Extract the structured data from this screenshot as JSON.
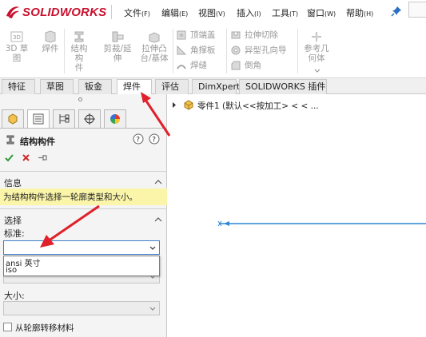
{
  "app": {
    "brand": "SOLIDWORKS",
    "brand_color": "#c8102e"
  },
  "menu": {
    "items": [
      {
        "label": "文件",
        "accel": "(F)"
      },
      {
        "label": "编辑",
        "accel": "(E)"
      },
      {
        "label": "视图",
        "accel": "(V)"
      },
      {
        "label": "插入",
        "accel": "(I)"
      },
      {
        "label": "工具",
        "accel": "(T)"
      },
      {
        "label": "窗口",
        "accel": "(W)"
      },
      {
        "label": "帮助",
        "accel": "(H)"
      }
    ]
  },
  "commands": {
    "sketch_3d": "3D 草图",
    "weldment": "焊件",
    "structural_member_l1": "结构构",
    "structural_member_l2": "件",
    "trim_extend_l1": "剪裁/延",
    "trim_extend_l2": "伸",
    "extruded_boss_l1": "拉伸凸",
    "extruded_boss_l2": "台/基体",
    "end_cap": "顶端盖",
    "gusset": "角撑板",
    "weld_bead": "焊缝",
    "extruded_cut": "拉伸切除",
    "hole_wizard": "异型孔向导",
    "chamfer": "倒角",
    "ref_geometry_l1": "参考几",
    "ref_geometry_l2": "何体"
  },
  "tabs": [
    {
      "label": "特征",
      "active": false
    },
    {
      "label": "草图",
      "active": false
    },
    {
      "label": "钣金",
      "active": false
    },
    {
      "label": "焊件",
      "active": true
    },
    {
      "label": "评估",
      "active": false
    },
    {
      "label": "DimXpert",
      "active": false
    },
    {
      "label": "SOLIDWORKS 插件",
      "active": false
    }
  ],
  "property_manager": {
    "title": "结构构件",
    "info_section": "信息",
    "info_text": "为结构构件选择一轮廓类型和大小。",
    "selection_section": "选择",
    "standard_label": "标准:",
    "standard_value": "",
    "dropdown_options": [
      "ansi 英寸",
      "iso"
    ],
    "size_label": "大小:",
    "size_value": "",
    "transfer_material_label": "从轮廓转移材料",
    "transfer_material_checked": false
  },
  "feature_tree": {
    "part_label": "零件1  (默认<<按加工> < < ..."
  },
  "colors": {
    "annotation_red": "#e0202a",
    "sketch_line": "#2f86d6",
    "info_bg": "#fbf5a9"
  }
}
